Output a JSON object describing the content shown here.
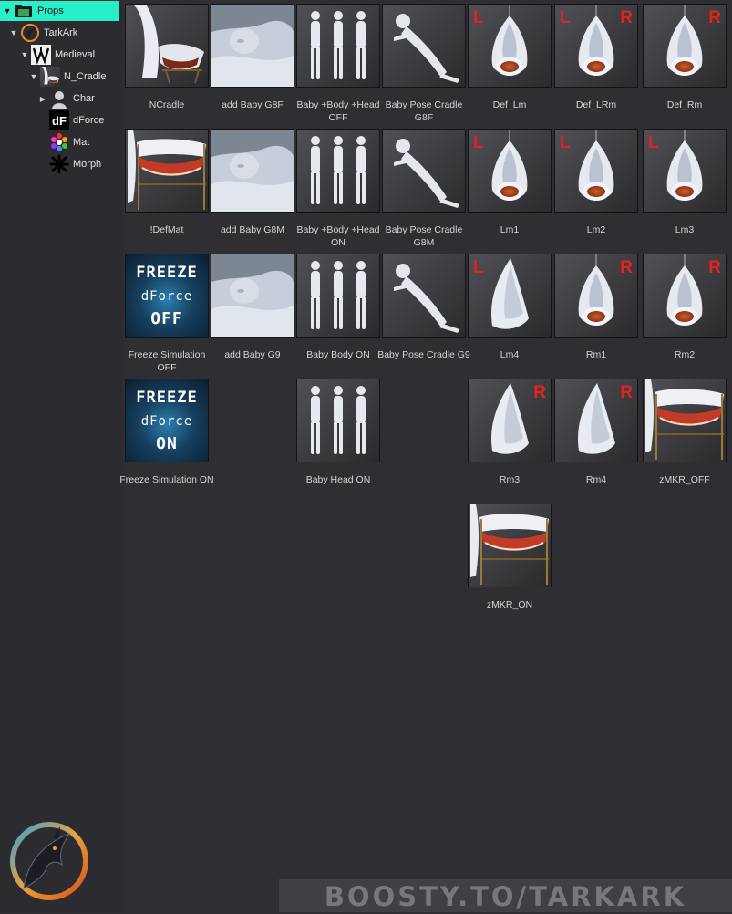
{
  "tree": {
    "props": "Props",
    "tarkark": "TarkArk",
    "medieval": "Medieval",
    "ncradle": "N_Cradle",
    "char": "Char",
    "dforce": "dForce",
    "mat": "Mat",
    "morph": "Morph",
    "dforce_icon_text": "dF"
  },
  "items": {
    "ncradle": "NCradle",
    "add_baby_g8f": "add Baby G8F",
    "baby_body_head_off": "Baby +Body +Head OFF",
    "baby_pose_cradle_g8f": "Baby Pose Cradle G8F",
    "def_lm": "Def_Lm",
    "def_lrm": "Def_LRm",
    "def_rm": "Def_Rm",
    "defmat": "!DefMat",
    "add_baby_g8m": "add Baby G8M",
    "baby_body_head_on": "Baby +Body +Head ON",
    "baby_pose_cradle_g8m": "Baby Pose Cradle G8M",
    "lm1": "Lm1",
    "lm2": "Lm2",
    "lm3": "Lm3",
    "freeze_sim_off": "Freeze Simulation OFF",
    "add_baby_g9": "add Baby G9",
    "baby_body_on": "Baby Body ON",
    "baby_pose_cradle_g9": "Baby Pose Cradle G9",
    "lm4": "Lm4",
    "rm1": "Rm1",
    "rm2": "Rm2",
    "freeze_sim_on": "Freeze Simulation ON",
    "baby_head_on": "Baby Head ON",
    "rm3": "Rm3",
    "rm4": "Rm4",
    "zmkr_off": "zMKR_OFF",
    "zmkr_on": "zMKR_ON"
  },
  "badges": {
    "left": "L",
    "right": "R"
  },
  "freeze": {
    "line1": "FREEZE",
    "line2": "dForce",
    "off": "OFF",
    "on": "ON"
  },
  "watermark": "BOOSTY.TO/TARKARK",
  "colors": {
    "selection": "#27f0c8",
    "badge_red": "#e5211f",
    "background": "#2f2f33"
  }
}
